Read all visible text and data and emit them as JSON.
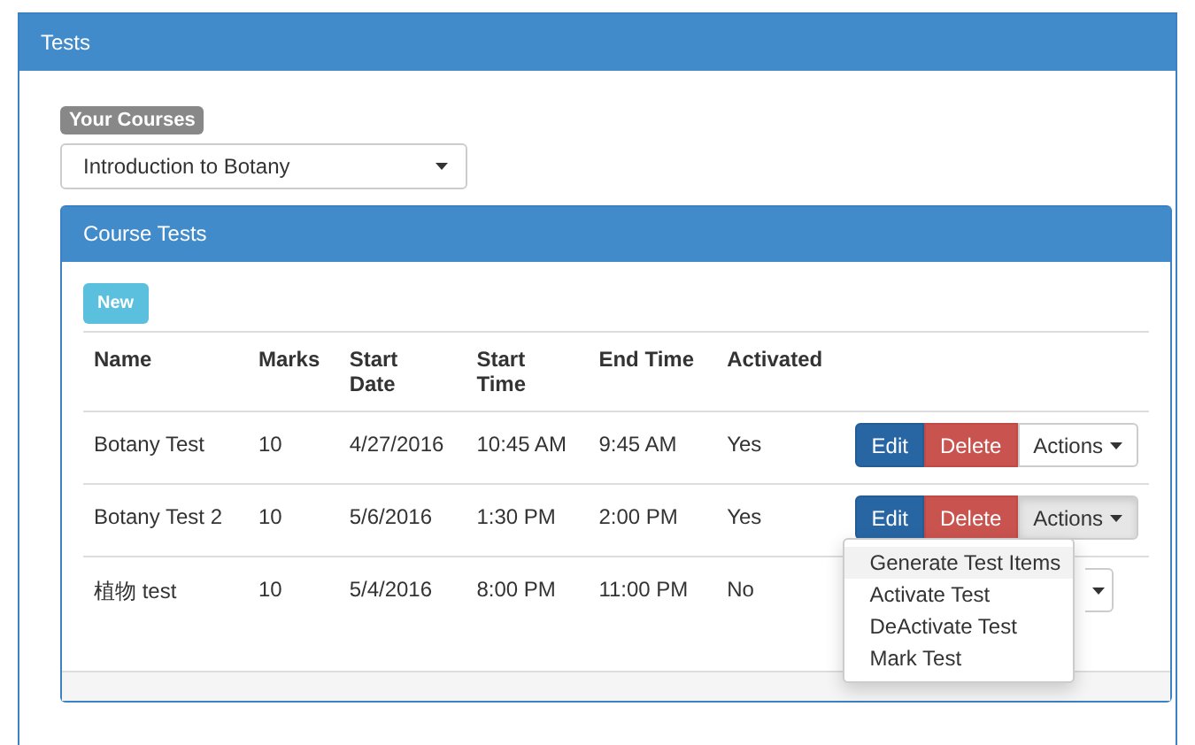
{
  "panel": {
    "title": "Tests"
  },
  "courses": {
    "label": "Your Courses",
    "value": "Introduction to Botany"
  },
  "course_tests": {
    "title": "Course Tests",
    "new_button": "New",
    "columns": [
      {
        "lines": [
          "Name"
        ]
      },
      {
        "lines": [
          "Marks"
        ]
      },
      {
        "lines": [
          "Start",
          "Date"
        ]
      },
      {
        "lines": [
          "Start",
          "Time"
        ]
      },
      {
        "lines": [
          "End Time"
        ]
      },
      {
        "lines": [
          "Activated"
        ]
      }
    ],
    "rows": [
      {
        "cells": [
          "Botany Test",
          "10",
          "4/27/2016",
          "10:45 AM",
          "9:45 AM",
          "Yes"
        ],
        "kind": "buttons",
        "edit": "Edit",
        "delete": "Delete",
        "actions": "Actions",
        "actions_open": false
      },
      {
        "cells": [
          "Botany Test 2",
          "10",
          "5/6/2016",
          "1:30 PM",
          "2:00 PM",
          "Yes"
        ],
        "kind": "buttons",
        "edit": "Edit",
        "delete": "Delete",
        "actions": "Actions",
        "actions_open": true
      },
      {
        "cells": [
          "植物 test",
          "10",
          "5/4/2016",
          "8:00 PM",
          "11:00 PM",
          "No"
        ],
        "kind": "covered"
      }
    ],
    "menu": [
      {
        "label": "Generate Test Items",
        "selected": true
      },
      {
        "label": "Activate Test",
        "selected": false
      },
      {
        "label": "DeActivate Test",
        "selected": false
      },
      {
        "label": "Mark Test",
        "selected": false
      }
    ]
  }
}
